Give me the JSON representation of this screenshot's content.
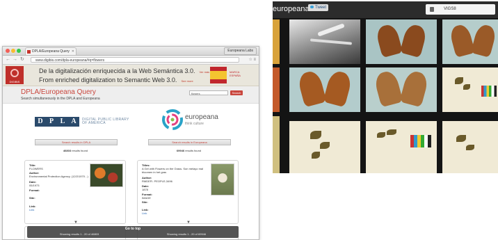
{
  "browser": {
    "tab_title": "DPLA/Europeana Query",
    "profile": "Europeana Labs",
    "url": "www.digibis.com/dpla-europeana/#q=flowers"
  },
  "banner": {
    "line_es": "De la digitalización enriquecida a la Web Semántica 3.0.",
    "line_es_link": "Ver más",
    "line_en": "From enriched digitalization to Semantic Web 3.0.",
    "line_en_link": "See more",
    "logo_text": "DIGIBIS",
    "flag_label": "MARCA ESPAÑA"
  },
  "page": {
    "title": "DPLA/Europeana Query",
    "subtitle": "Search simultaneously in the DPLA and Europeana",
    "search_value": "flowers",
    "search_button": "Search"
  },
  "dpla": {
    "logo_letters": [
      "D",
      "P",
      "L",
      "A"
    ],
    "logo_text_1": "DIGITAL PUBLIC LIBRARY",
    "logo_text_2": "OF AMERICA",
    "results_button": "Search results in DPLA",
    "count": "46803",
    "count_label": "results found"
  },
  "europeana": {
    "name": "europeana",
    "tagline": "think culture",
    "results_button": "Search results in Europeana",
    "count": "69946",
    "count_label": "results found"
  },
  "cards": {
    "left": {
      "title_label": "Title:",
      "title": "FLOWERS",
      "author_label": "Author:",
      "author": "Environmental Protection Agency. (12/2/1970 - )",
      "date_label": "Date:",
      "date": "05/1973",
      "format_label": "Format:",
      "format": "",
      "site_label": "Site:",
      "site": "",
      "link_label": "Link:",
      "link": "Link"
    },
    "right": {
      "title_label": "Titles:",
      "title": "A Girl with Flowers on the Grass. Son melayo mal bloomen in het gras",
      "author_label": "Author:",
      "author": "RMDEFI. PEOPLE-3496",
      "date_label": "Date:",
      "date": "1878",
      "format_label": "Format:",
      "format": "IMAGE",
      "site_label": "Site:",
      "site": "",
      "link_label": "Link:",
      "link": "Link"
    }
  },
  "footer": {
    "go_top": "Go to top",
    "left": "Showing results 1 - 20 of 46803",
    "right": "Showing results 1 - 20 of 69946"
  },
  "euro_view": {
    "name": "europeana",
    "tweet": "Tweet",
    "search_value": "VIGS8"
  }
}
